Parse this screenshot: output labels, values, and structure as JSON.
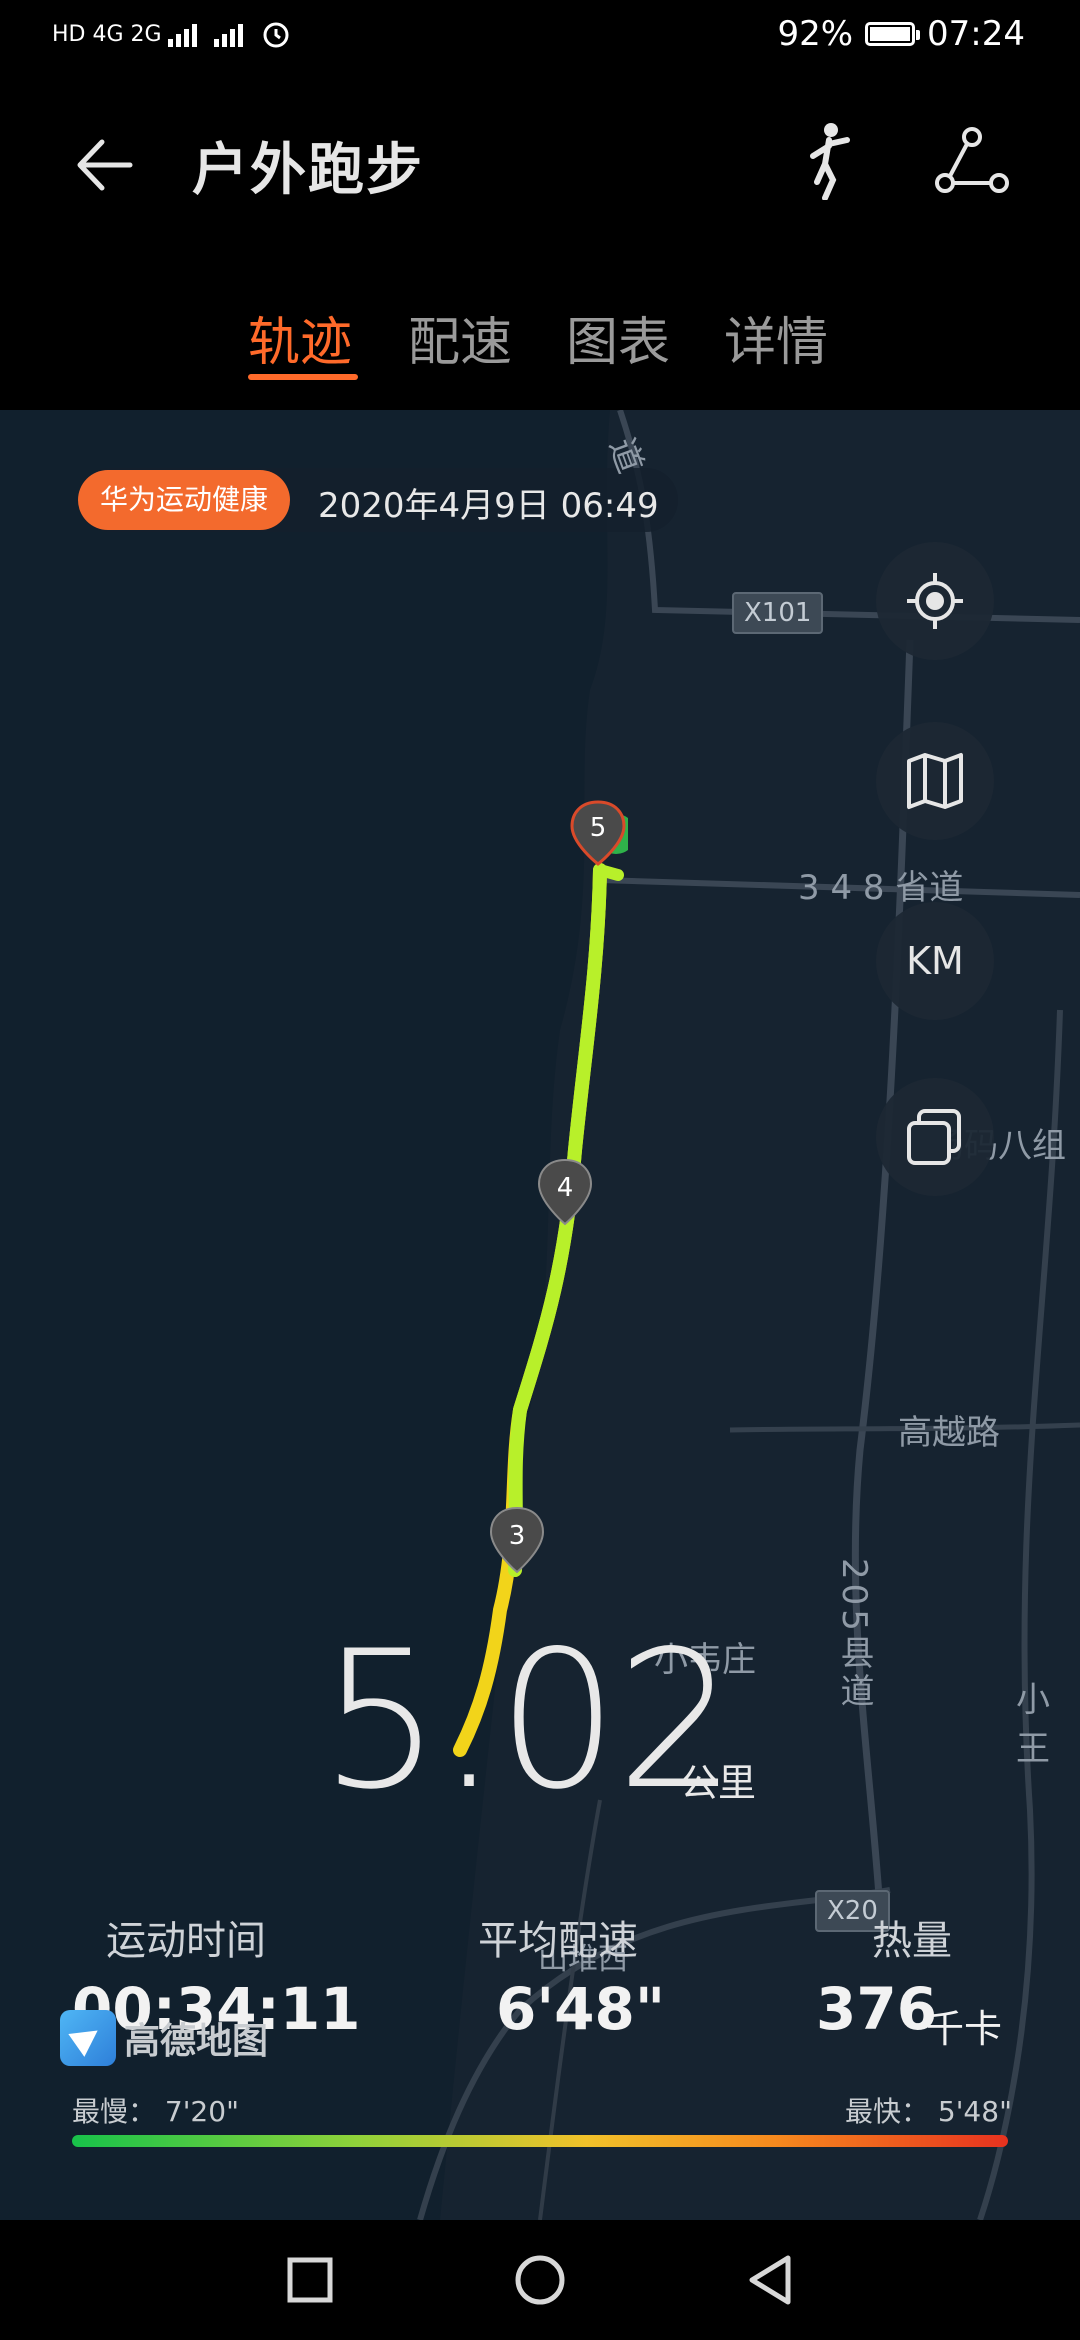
{
  "status_bar": {
    "left_indicators": "HD 4G 2G",
    "battery": "92%",
    "time": "07:24",
    "battery_level": 0.92
  },
  "header": {
    "title": "户外跑步",
    "icons": [
      "back-arrow-icon",
      "running-figure-icon",
      "route-nodes-icon"
    ]
  },
  "tabs": [
    {
      "label": "轨迹",
      "active": true
    },
    {
      "label": "配速",
      "active": false
    },
    {
      "label": "图表",
      "active": false
    },
    {
      "label": "详情",
      "active": false
    }
  ],
  "map": {
    "source_badge": "华为运动健康",
    "datetime": "2020年4月9日 06:49",
    "controls": [
      {
        "icon": "locate-icon"
      },
      {
        "icon": "map-icon"
      },
      {
        "label": "KM"
      },
      {
        "icon": "layers-icon"
      }
    ],
    "labels": {
      "road_x101": "X101",
      "road_x20": "X20",
      "provincial_road": "3 4 8 省道",
      "village_group": "杨码八组",
      "gaoyue_road": "高越路",
      "xiaoweizhuang": "小韦庄",
      "county_road": "205县道",
      "xiaowang": "小王",
      "shandui": "山堆西",
      "top_road": "道"
    },
    "km_markers": [
      "3",
      "4",
      "5"
    ],
    "attribution": "高德地图",
    "colors": {
      "route_fast": "#b8f02a",
      "route_slow": "#f5d21a",
      "accent": "#f36a2d"
    }
  },
  "summary": {
    "distance": "5.02",
    "distance_unit": "公里",
    "duration_label": "运动时间",
    "duration": "00:34:11",
    "pace_label": "平均配速",
    "pace": "6'48\"",
    "calories_label": "热量",
    "calories": "376",
    "calories_unit": "千卡"
  },
  "pace_legend": {
    "slowest_label": "最慢：",
    "slowest": "7'20\"",
    "fastest_label": "最快：",
    "fastest": "5'48\""
  },
  "navbar": [
    "recent-apps-icon",
    "home-icon",
    "back-icon"
  ]
}
